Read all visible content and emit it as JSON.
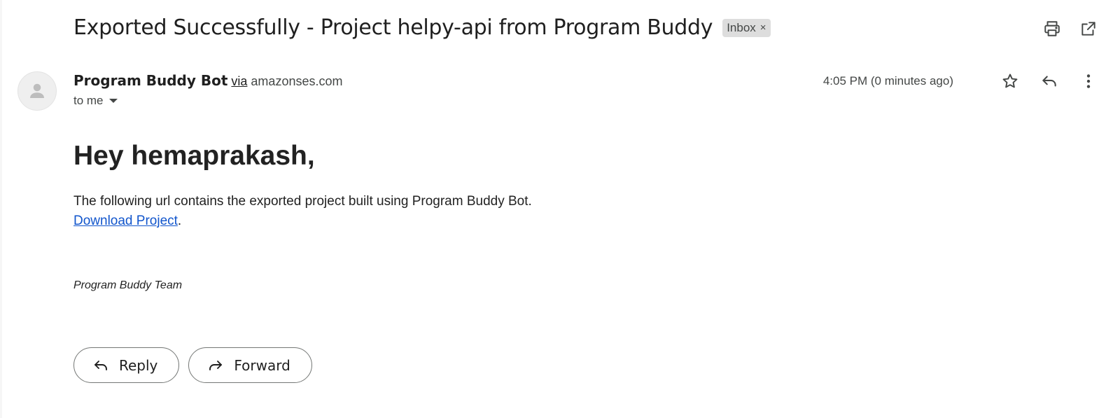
{
  "email": {
    "subject": "Exported Successfully - Project helpy-api from Program Buddy",
    "label": {
      "name": "Inbox",
      "remove_glyph": "×"
    },
    "sender": {
      "name": "Program Buddy Bot",
      "via_label": "via",
      "via_domain": "amazonses.com"
    },
    "recipient_line": "to me",
    "timestamp": "4:05 PM (0 minutes ago)",
    "body": {
      "greeting": "Hey hemaprakash,",
      "paragraph": "The following url contains the exported project built using Program Buddy Bot.",
      "link_text": "Download Project",
      "link_suffix": ".",
      "signature": "Program Buddy Team"
    }
  },
  "actions": {
    "reply_label": "Reply",
    "forward_label": "Forward"
  },
  "icons": {
    "print": "print-icon",
    "open_new_window": "open-in-new-icon",
    "star": "star-icon",
    "reply": "reply-icon",
    "more": "more-vert-icon",
    "avatar": "person-icon",
    "forward": "forward-icon"
  },
  "colors": {
    "link": "#1155cc",
    "chip_bg": "#dddddd",
    "text": "#1f1f1f",
    "secondary_text": "#444746"
  }
}
